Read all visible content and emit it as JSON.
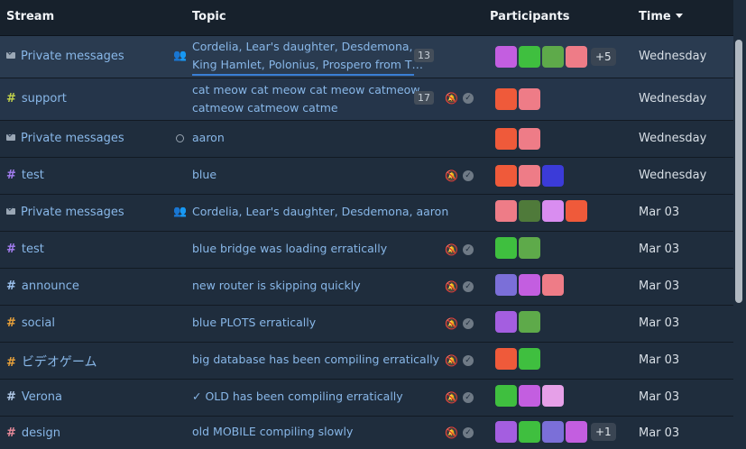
{
  "header": {
    "stream": "Stream",
    "topic": "Topic",
    "participants": "Participants",
    "time": "Time"
  },
  "rows": [
    {
      "stream": "Private messages",
      "topic_line1": "Cordelia, Lear's daughter, Desdemona,",
      "topic_line2": "King Hamlet, Polonius, Prospero from T…",
      "count": "13",
      "more": "+5",
      "time": "Wednesday"
    },
    {
      "stream": "support",
      "topic_line1": "cat meow cat meow cat meow catmeow",
      "topic_line2": "catmeow catmeow catme",
      "count": "17",
      "time": "Wednesday"
    },
    {
      "stream": "Private messages",
      "topic": "aaron",
      "time": "Wednesday"
    },
    {
      "stream": "test",
      "topic": "blue",
      "time": "Wednesday"
    },
    {
      "stream": "Private messages",
      "topic": "Cordelia, Lear's daughter, Desdemona, aaron",
      "time": "Mar 03"
    },
    {
      "stream": "test",
      "topic": "blue bridge was loading erratically",
      "time": "Mar 03"
    },
    {
      "stream": "announce",
      "topic": "new router is skipping quickly",
      "time": "Mar 03"
    },
    {
      "stream": "social",
      "topic": "blue PLOTS erratically",
      "time": "Mar 03"
    },
    {
      "stream": "ビデオゲーム",
      "topic": "big database has been compiling erratically",
      "time": "Mar 03"
    },
    {
      "stream": "Verona",
      "topic": "✓ OLD has been compiling erratically",
      "time": "Mar 03"
    },
    {
      "stream": "design",
      "topic": "old MOBILE compiling slowly",
      "more": "+1",
      "time": "Mar 03"
    }
  ],
  "colors": {
    "stream_support": "#c2d24b",
    "stream_test": "#a47ef2",
    "stream_announce": "#9dc3f0",
    "stream_social": "#e8a13a",
    "stream_video": "#e8a13a",
    "stream_verona": "#b1c9e8",
    "stream_design": "#e88a9a"
  }
}
